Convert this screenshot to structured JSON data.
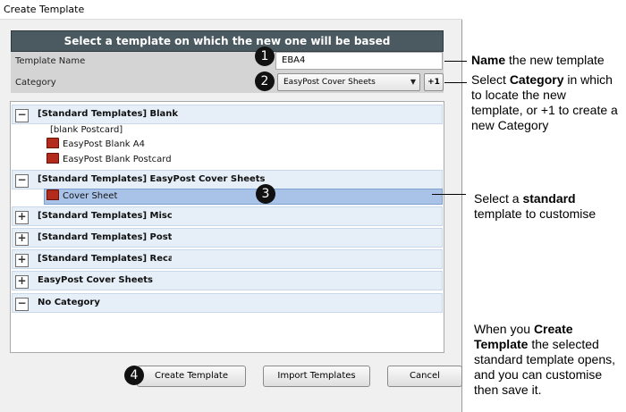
{
  "window": {
    "title": "Create Template"
  },
  "dialog": {
    "banner": "Select a template on which the new one will be based",
    "template_name_label": "Template Name",
    "template_name_value": "EBA4",
    "category_label": "Category",
    "category_value": "EasyPost Cover Sheets",
    "add_category_label": "+1"
  },
  "tree": {
    "groups": [
      {
        "label": "[Standard Templates] Blank",
        "toggle": "−",
        "items": [
          "[blank Postcard]",
          "EasyPost Blank A4",
          "EasyPost Blank Postcard"
        ]
      },
      {
        "label": "[Standard Templates] EasyPost Cover Sheets",
        "toggle": "−",
        "items": [
          "Cover Sheet"
        ]
      },
      {
        "label": "[Standard Templates] Misc",
        "toggle": "+"
      },
      {
        "label": "[Standard Templates] Postcard",
        "toggle": "+"
      },
      {
        "label": "[Standard Templates] Recall Le",
        "toggle": "+"
      },
      {
        "label": "EasyPost Cover Sheets",
        "toggle": "+"
      },
      {
        "label": "No Category",
        "toggle": "−"
      }
    ]
  },
  "buttons": {
    "create": "Create Template",
    "import": "Import Templates",
    "cancel": "Cancel"
  },
  "badges": [
    "1",
    "2",
    "3",
    "4"
  ],
  "annotations": {
    "a1_bold": "Name",
    "a1_rest": " the new template",
    "a2_pre": "Select ",
    "a2_bold": "Category",
    "a2_rest": " in which to locate the new template, or +1 to create a new Category",
    "a3_pre": "Select a ",
    "a3_bold": "standard",
    "a3_rest": " template to customise",
    "a4_pre": "When you ",
    "a4_bold": "Create Template",
    "a4_rest": " the selected standard template opens, and you can customise then save it."
  },
  "colors": {
    "banner": "#4b5a60",
    "selection": "#a9c3e8",
    "group_row": "#e6eff8"
  }
}
